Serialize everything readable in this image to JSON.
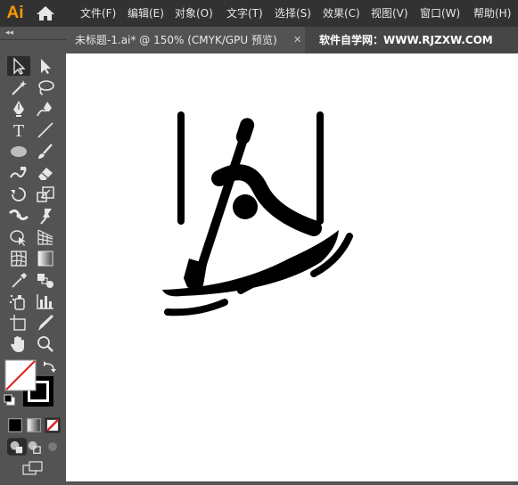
{
  "app": {
    "logo": "Ai"
  },
  "menu": [
    "文件(F)",
    "编辑(E)",
    "对象(O)",
    "文字(T)",
    "选择(S)",
    "效果(C)",
    "视图(V)",
    "窗口(W)",
    "帮助(H)"
  ],
  "tab": {
    "title": "未标题-1.ai* @ 150% (CMYK/GPU 预览)",
    "close": "✕"
  },
  "watermark": "软件自学网：WWW.RJZXW.COM",
  "toolbar": {
    "collapse": "◂◂"
  },
  "tools": [
    {
      "name": "selection-tool-icon"
    },
    {
      "name": "direct-selection-tool-icon"
    },
    {
      "name": "magic-wand-tool-icon"
    },
    {
      "name": "lasso-tool-icon"
    },
    {
      "name": "pen-tool-icon"
    },
    {
      "name": "curvature-tool-icon"
    },
    {
      "name": "type-tool-icon"
    },
    {
      "name": "line-segment-tool-icon"
    },
    {
      "name": "ellipse-tool-icon"
    },
    {
      "name": "paintbrush-tool-icon"
    },
    {
      "name": "shaper-tool-icon"
    },
    {
      "name": "eraser-tool-icon"
    },
    {
      "name": "rotate-tool-icon"
    },
    {
      "name": "scale-tool-icon"
    },
    {
      "name": "width-tool-icon"
    },
    {
      "name": "puppet-warp-tool-icon"
    },
    {
      "name": "shape-builder-tool-icon"
    },
    {
      "name": "perspective-grid-tool-icon"
    },
    {
      "name": "mesh-tool-icon"
    },
    {
      "name": "gradient-tool-icon"
    },
    {
      "name": "eyedropper-tool-icon"
    },
    {
      "name": "blend-tool-icon"
    },
    {
      "name": "symbol-sprayer-tool-icon"
    },
    {
      "name": "column-graph-tool-icon"
    },
    {
      "name": "artboard-tool-icon"
    },
    {
      "name": "slice-tool-icon"
    },
    {
      "name": "hand-tool-icon"
    },
    {
      "name": "zoom-tool-icon"
    }
  ],
  "colors": {
    "menubar": "#323232",
    "panel": "#535353",
    "tabbar": "#464646",
    "accent_logo": "#ff9a00",
    "artwork": "#000000",
    "no_fill_slash": "#e02020"
  }
}
